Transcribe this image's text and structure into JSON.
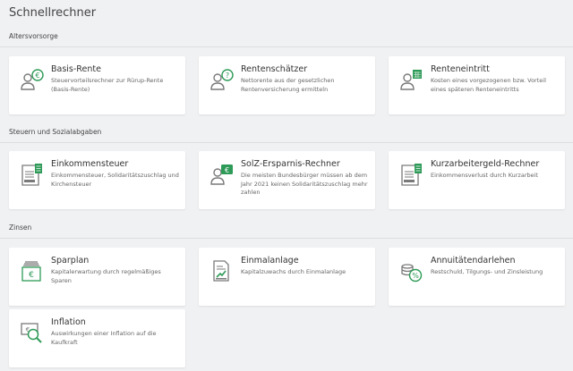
{
  "page_title": "Schnellrechner",
  "colors": {
    "accent": "#2e9a57",
    "icon_gray": "#7a7a7a",
    "background": "#f0f1f3"
  },
  "sections": [
    {
      "title": "Altersvorsorge",
      "cards": [
        {
          "title": "Basis-Rente",
          "description": "Steuervorteilsrechner zur Rürup-Rente (Basis-Rente)",
          "icon": "person-euro-icon"
        },
        {
          "title": "Rentenschätzer",
          "description": "Nettorente aus der gesetzlichen Rentenversicherung ermitteln",
          "icon": "person-question-icon"
        },
        {
          "title": "Renteneintritt",
          "description": "Kosten eines vorgezogenen bzw. Vorteil eines späteren Renteneintritts",
          "icon": "person-calendar-icon"
        }
      ]
    },
    {
      "title": "Steuern und Sozialabgaben",
      "cards": [
        {
          "title": "Einkommensteuer",
          "description": "Einkommensteuer, Solidaritätszuschlag und Kirchensteuer",
          "icon": "tax-form-calculator-icon"
        },
        {
          "title": "SolZ-Ersparnis-Rechner",
          "description": "Die meisten Bundesbürger müssen ab dem Jahr 2021 keinen Solidaritätszuschlag mehr zahlen",
          "icon": "person-euro-badge-icon"
        },
        {
          "title": "Kurzarbeitergeld-Rechner",
          "description": "Einkommensverlust durch Kurzarbeit",
          "icon": "tax-form-calculator-icon"
        }
      ]
    },
    {
      "title": "Zinsen",
      "cards": [
        {
          "title": "Sparplan",
          "description": "Kapitalerwartung durch regelmäßiges Sparen",
          "icon": "savings-box-euro-icon"
        },
        {
          "title": "Einmalanlage",
          "description": "Kapitalzuwachs durch Einmalanlage",
          "icon": "document-growth-icon"
        },
        {
          "title": "Annuitätendarlehen",
          "description": "Restschuld, Tilgungs- und Zinsleistung",
          "icon": "coins-percent-icon"
        },
        {
          "title": "Inflation",
          "description": "Auswirkungen einer Inflation auf die Kaufkraft",
          "icon": "euro-magnifier-icon"
        }
      ]
    }
  ]
}
